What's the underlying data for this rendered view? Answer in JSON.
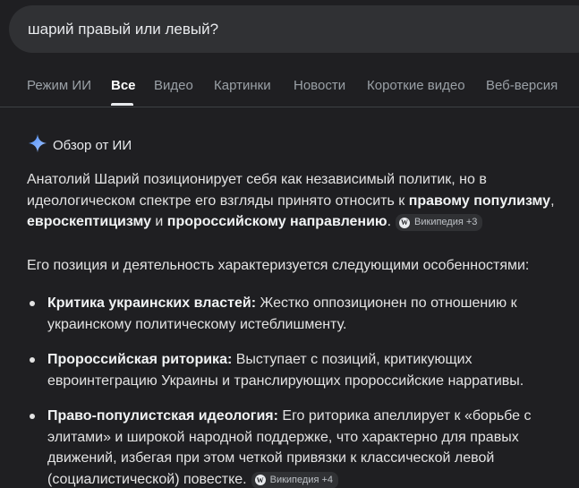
{
  "search": {
    "query": "шарий правый или левый?"
  },
  "tabs": [
    {
      "label": "Режим ИИ"
    },
    {
      "label": "Все"
    },
    {
      "label": "Видео"
    },
    {
      "label": "Картинки"
    },
    {
      "label": "Новости"
    },
    {
      "label": "Короткие видео"
    },
    {
      "label": "Веб-версия"
    }
  ],
  "active_tab": "Все",
  "overview": {
    "title": "Обзор от ИИ",
    "p1": {
      "text_a": "Анатолий Шарий позиционирует себя как независимый политик, но в идеологическом спектре его взгляды принято относить к ",
      "bold_a": "правому популизму",
      "text_b": ", ",
      "bold_b": "евроскептицизму",
      "text_c": " и ",
      "bold_c": "пророссийскому направлению",
      "text_d": ".",
      "chip": "Википедия +3"
    },
    "p2": "Его позиция и деятельность характеризуется следующими особенностями:",
    "bullets": [
      {
        "bold": "Критика украинских властей:",
        "text": " Жестко оппозиционен по отношению к украинскому политическому истеблишменту."
      },
      {
        "bold": "Пророссийская риторика:",
        "text": " Выступает с позиций, критикующих евроинтеграцию Украины и транслирующих пророссийские нарративы."
      },
      {
        "bold": "Право-популистская идеология:",
        "text": " Его риторика апеллирует к «борьбе с элитами» и широкой народной поддержке, что характерно для правых движений, избегая при этом четкой привязки к классической левой (социалистической) повестке.",
        "chip": "Википедия +4"
      }
    ]
  },
  "colors": {
    "background": "#1f1f22",
    "search_bg": "#303134",
    "sparkle": "#7aa7ff",
    "chip_bg": "#303134"
  }
}
